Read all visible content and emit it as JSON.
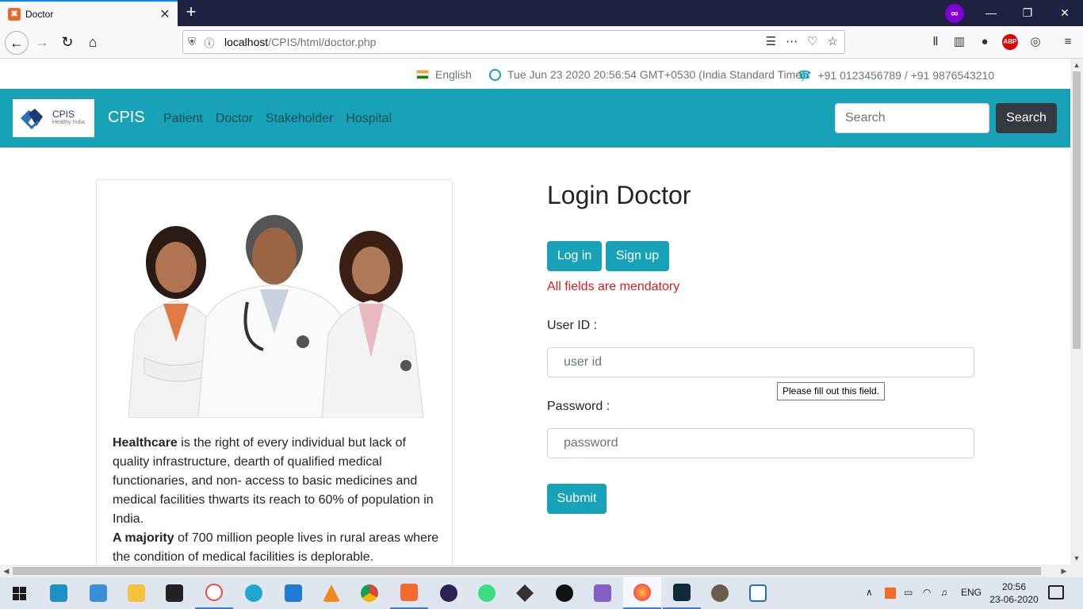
{
  "browser": {
    "tab_title": "Doctor",
    "tab_favicon": "xampp-icon",
    "url_host": "localhost",
    "url_path": "/CPIS/html/doctor.php"
  },
  "topbar": {
    "language": "English",
    "datetime": "Tue Jun 23 2020 20:56:54 GMT+0530 (India Standard Time)",
    "phones": "+91 0123456789 / +91 9876543210"
  },
  "header": {
    "logo_title": "CPIS",
    "logo_subtitle": "Healthy India",
    "brand": "CPIS",
    "nav": [
      "Patient",
      "Doctor",
      "Stakeholder",
      "Hospital"
    ],
    "search_placeholder": "Search",
    "search_button": "Search",
    "color": "#17a2b8"
  },
  "info_card": {
    "p1_bold": "Healthcare",
    "p1_text": " is the right of every individual but lack of quality infrastructure, dearth of qualified medical functionaries, and non- access to basic medicines and medical facilities thwarts its reach to 60% of population in India.",
    "p2_bold": "A majority",
    "p2_text": " of 700 million people lives in rural areas where the condition of medical facilities is deplorable."
  },
  "login": {
    "title": "Login Doctor",
    "login_tab": "Log in",
    "signup_tab": "Sign up",
    "error": "All fields are mendatory",
    "userid_label": "User ID :",
    "userid_placeholder": "user id",
    "password_label": "Password :",
    "password_placeholder": "password",
    "submit": "Submit",
    "validation_tooltip": "Please fill out this field."
  },
  "taskbar": {
    "language": "ENG",
    "time": "20:56",
    "date": "23-06-2020"
  }
}
